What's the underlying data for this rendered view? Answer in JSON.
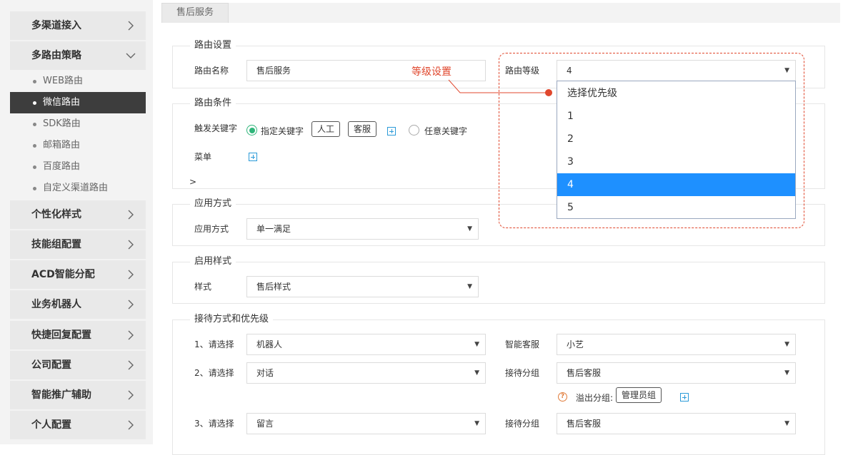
{
  "sidebar": {
    "headers": [
      {
        "label": "多渠道接入",
        "icon": "chevron-right-icon"
      },
      {
        "label": "多路由策略",
        "icon": "chevron-down-icon"
      },
      {
        "label": "个性化样式",
        "icon": "chevron-right-icon"
      },
      {
        "label": "技能组配置",
        "icon": "chevron-right-icon"
      },
      {
        "label": "ACD智能分配",
        "icon": "chevron-right-icon"
      },
      {
        "label": "业务机器人",
        "icon": "chevron-right-icon"
      },
      {
        "label": "快捷回复配置",
        "icon": "chevron-right-icon"
      },
      {
        "label": "公司配置",
        "icon": "chevron-right-icon"
      },
      {
        "label": "智能推广辅助",
        "icon": "chevron-right-icon"
      },
      {
        "label": "个人配置",
        "icon": "chevron-right-icon"
      }
    ],
    "sub_items": [
      {
        "label": "WEB路由",
        "active": false
      },
      {
        "label": "微信路由",
        "active": true
      },
      {
        "label": "SDK路由",
        "active": false
      },
      {
        "label": "邮箱路由",
        "active": false
      },
      {
        "label": "百度路由",
        "active": false
      },
      {
        "label": "自定义渠道路由",
        "active": false
      }
    ]
  },
  "tab": {
    "label": "售后服务"
  },
  "route_settings": {
    "legend": "路由设置",
    "name_label": "路由名称",
    "name_value": "售后服务",
    "level_label": "路由等级",
    "level_value": "4"
  },
  "route_conditions": {
    "legend": "路由条件",
    "trigger_label": "触发关键字",
    "radio_specified": "指定关键字",
    "tags": [
      "人工",
      "客服"
    ],
    "radio_any": "任意关键字",
    "menu_label": "菜单",
    "expand": ">"
  },
  "apply_mode": {
    "legend": "应用方式",
    "label": "应用方式",
    "value": "单一满足"
  },
  "style": {
    "legend": "启用样式",
    "label": "样式",
    "value": "售后样式"
  },
  "reception": {
    "legend": "接待方式和优先级",
    "rows": [
      {
        "label": "1、请选择",
        "value": "机器人",
        "right_label": "智能客服",
        "right_value": "小艺"
      },
      {
        "label": "2、请选择",
        "value": "对话",
        "right_label": "接待分组",
        "right_value": "售后客服"
      },
      {
        "label": "3、请选择",
        "value": "留言",
        "right_label": "接待分组",
        "right_value": "售后客服"
      }
    ],
    "overflow_label": "溢出分组:",
    "overflow_tag": "管理员组",
    "question_glyph": "?"
  },
  "level_dropdown": {
    "annotation": "等级设置",
    "options": [
      "选择优先级",
      "1",
      "2",
      "3",
      "4",
      "5"
    ],
    "selected": "4"
  },
  "colors": {
    "accent_blue": "#1e90ff",
    "annotation_red": "#e0472d",
    "radio_green": "#2fb57a",
    "sidebar_active": "#3d3d3d"
  },
  "caret_glyph": "▼"
}
